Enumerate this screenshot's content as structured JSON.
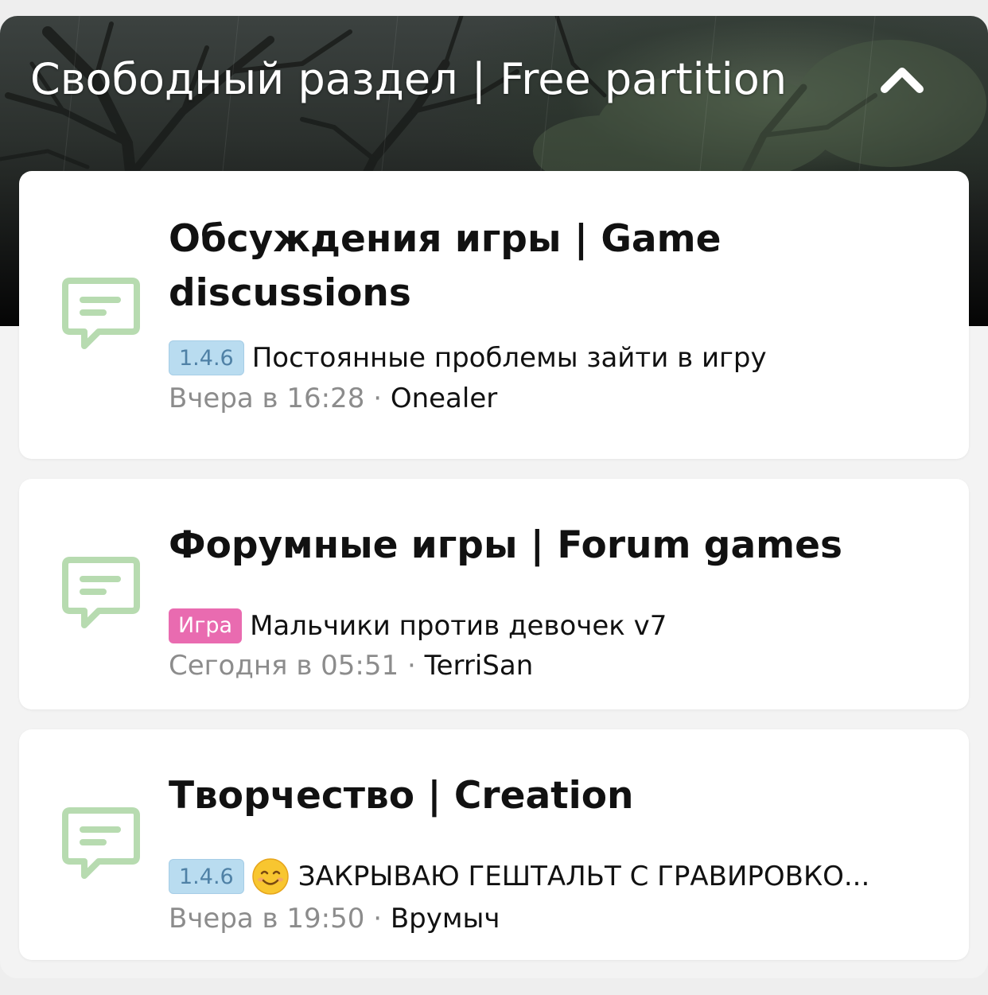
{
  "section": {
    "title": "Свободный раздел | Free partition",
    "collapse_icon": "chevron-up-icon"
  },
  "forums": [
    {
      "title": "Обсуждения игры | Game discussions",
      "icon": "chat-bubble-icon",
      "last_thread": {
        "prefix": "1.4.6",
        "prefix_color": "#b9dcf0",
        "title": "Постоянные проблемы зайти в игру"
      },
      "time": "Вчера в 16:28",
      "separator": "·",
      "author": "Onealer"
    },
    {
      "title": "Форумные игры | Forum games",
      "icon": "chat-bubble-icon",
      "last_thread": {
        "prefix": "Игра",
        "prefix_color": "#e96bb0",
        "title": "Мальчики против девочек v7"
      },
      "time": "Сегодня в 05:51",
      "separator": "·",
      "author": "TerriSan"
    },
    {
      "title": "Творчество | Creation",
      "icon": "chat-bubble-icon",
      "last_thread": {
        "prefix": "1.4.6",
        "prefix_color": "#b9dcf0",
        "emoji": "smiling-face-emoji",
        "title": "ЗАКРЫВАЮ ГЕШТАЛЬТ С ГРАВИРОВКО..."
      },
      "time": "Вчера в 19:50",
      "separator": "·",
      "author": "Врумыч"
    }
  ],
  "colors": {
    "icon_green": "#b7dbb0",
    "meta_gray": "#8c8c8c",
    "text": "#111111"
  }
}
